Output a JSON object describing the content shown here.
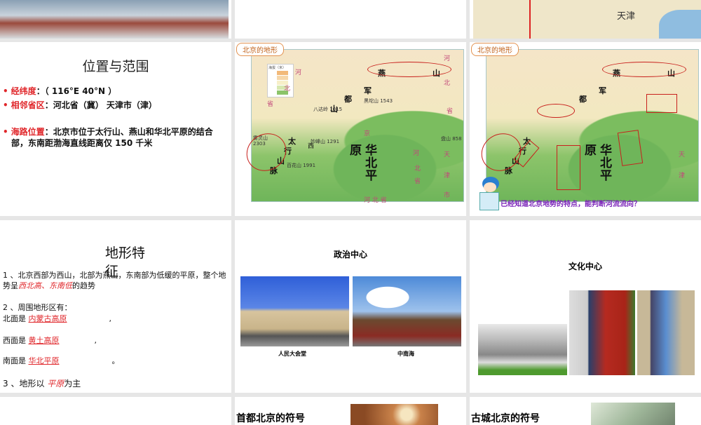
{
  "slides": {
    "location": {
      "title": "位置与范围",
      "bullets": [
        {
          "label": "经纬度",
          "text": "：（ 116°E        40°N ）"
        },
        {
          "label": "相邻省区",
          "text": "：河北省（冀）           天津市（津）"
        },
        {
          "label": "海路位置",
          "text": "：北京市位于太行山、燕山和华北平原的结合部，东南距渤海直线距离仅 150 千米"
        }
      ]
    },
    "map1": {
      "tab": "北京的地形",
      "legend_title": "海拔（米）",
      "legend": [
        "2000",
        "1000",
        "500",
        "200",
        "0"
      ],
      "labels": {
        "yan": "燕",
        "shan": "山",
        "taihang": [
          "太",
          "行",
          "山",
          "脉"
        ],
        "huabei": [
          "华",
          "北",
          "平"
        ],
        "yuan": "原",
        "jun": "军",
        "du": "都",
        "xi": "西",
        "peak1": "八达岭 1015",
        "peak2": "妙峰山 1291",
        "peak3": "黑坨山 1543",
        "peak4": "雾灵山 2303",
        "peak5": "百花山 1991",
        "peak6": "盘山 858",
        "he": "河",
        "bei": "北",
        "sheng": "省",
        "tian": "天",
        "jin": "津",
        "shi": "市",
        "hebeisheng": "河 北 省",
        "jing": "京"
      }
    },
    "map2": {
      "tab": "北京的地形",
      "question": "已经知道北京地势的特点，能判断河流流向？"
    },
    "top_map": {
      "label": "天津"
    },
    "terrain": {
      "title": "地形特征",
      "p1": "1 、北京西部为西山，北部为燕山，东南部为低缓的平原，整个地势呈",
      "p1_em": "西北高、东南低",
      "p1_end": "的趋势",
      "p2": "2 、周围地形区有：",
      "north": "北面是 ",
      "north_v": "内蒙古高原",
      "west": "西面是 ",
      "west_v": "黄土高原",
      "south": "南面是 ",
      "south_v": "华北平原",
      "p3": "3 、地形以 ",
      "p3_em": "平原",
      "p3_end": "为主"
    },
    "political": {
      "title": "政治中心",
      "captions": [
        "人民大会堂",
        "中南海"
      ]
    },
    "cultural": {
      "title": "文化中心"
    },
    "capital_symbol": {
      "title": "首都北京的符号"
    },
    "ancient_symbol": {
      "title": "古城北京的符号"
    }
  }
}
